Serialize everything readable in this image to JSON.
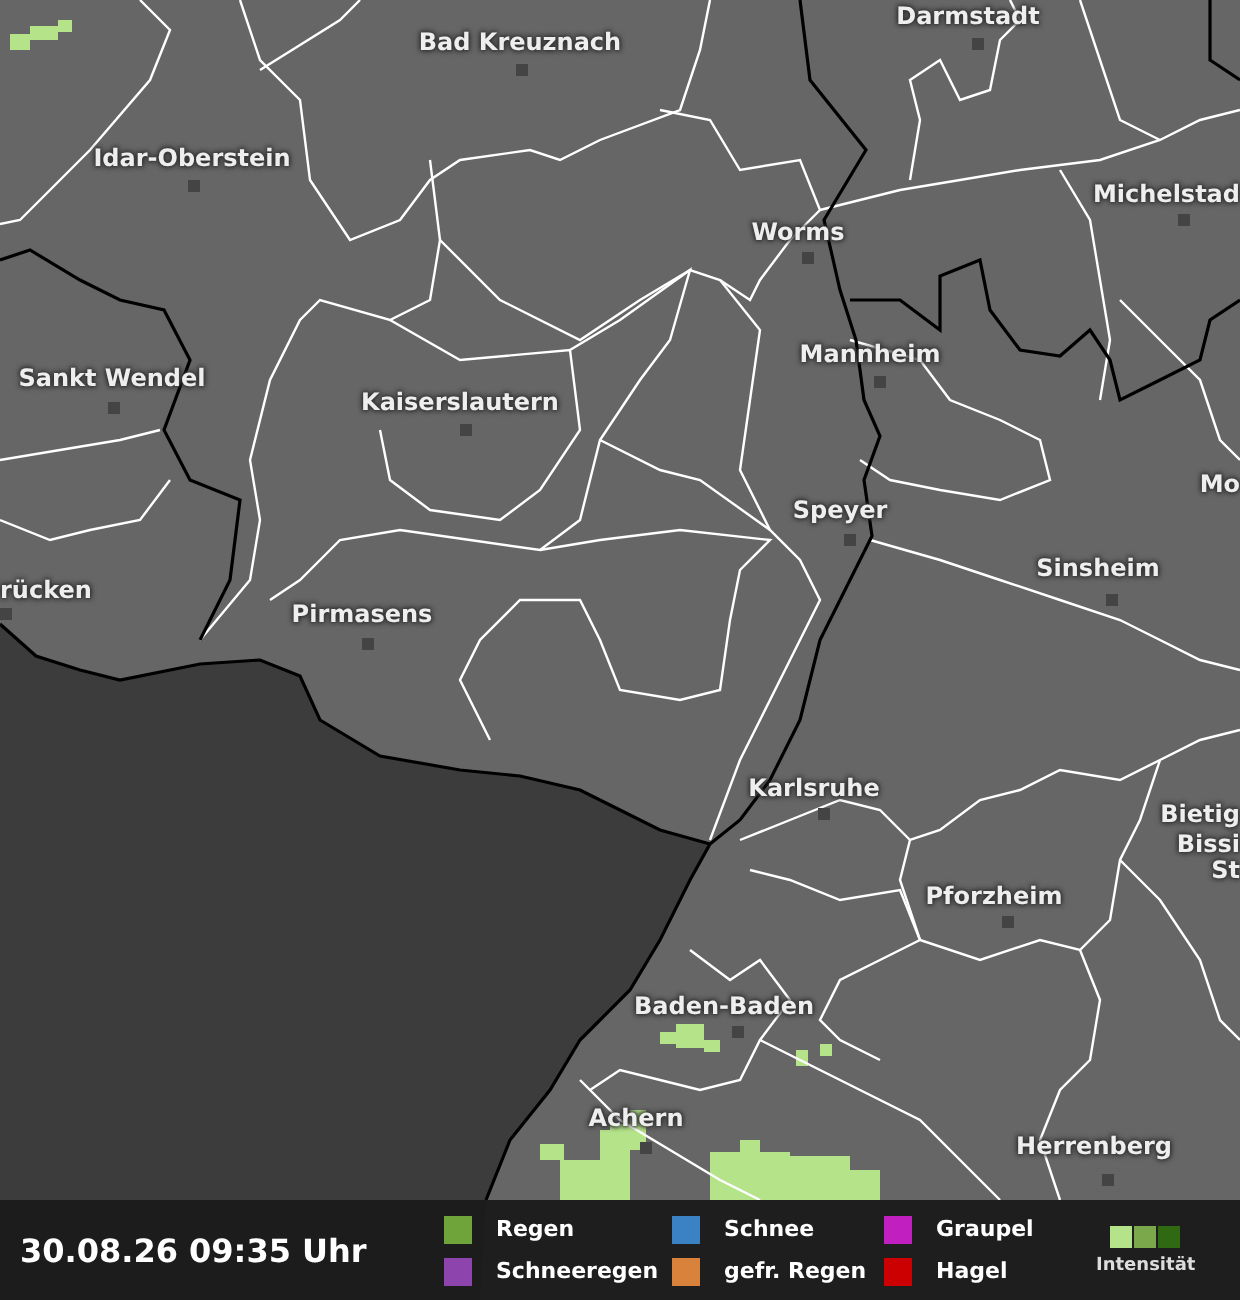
{
  "map": {
    "cities": [
      {
        "name": "Bad Kreuznach"
      },
      {
        "name": "Darmstadt"
      },
      {
        "name": "Idar-Oberstein"
      },
      {
        "name": "Michelstad"
      },
      {
        "name": "Worms"
      },
      {
        "name": "Sankt Wendel"
      },
      {
        "name": "Mannheim"
      },
      {
        "name": "Kaiserslautern"
      },
      {
        "name": "Mo"
      },
      {
        "name": "Speyer"
      },
      {
        "name": "Sinsheim"
      },
      {
        "name": "rücken"
      },
      {
        "name": "Pirmasens"
      },
      {
        "name": "Karlsruhe"
      },
      {
        "name": "Bietig"
      },
      {
        "name": "Bissi"
      },
      {
        "name": "Pforzheim"
      },
      {
        "name": "St"
      },
      {
        "name": "Baden-Baden"
      },
      {
        "name": "Achern"
      },
      {
        "name": "Herrenberg"
      }
    ]
  },
  "footer": {
    "timestamp": "30.08.26 09:35 Uhr",
    "legend": [
      {
        "label": "Regen",
        "color": "#6fa43a"
      },
      {
        "label": "Schneeregen",
        "color": "#8e44ad"
      },
      {
        "label": "Schnee",
        "color": "#3b82c4"
      },
      {
        "label": "gefr. Regen",
        "color": "#d9823b"
      },
      {
        "label": "Graupel",
        "color": "#c21fc0"
      },
      {
        "label": "Hagel",
        "color": "#cc0000"
      }
    ],
    "intensity": {
      "label": "Intensität",
      "steps": [
        {
          "color": "#b5e38a"
        },
        {
          "color": "#7aa84a"
        },
        {
          "color": "#2f6a12"
        }
      ]
    }
  }
}
